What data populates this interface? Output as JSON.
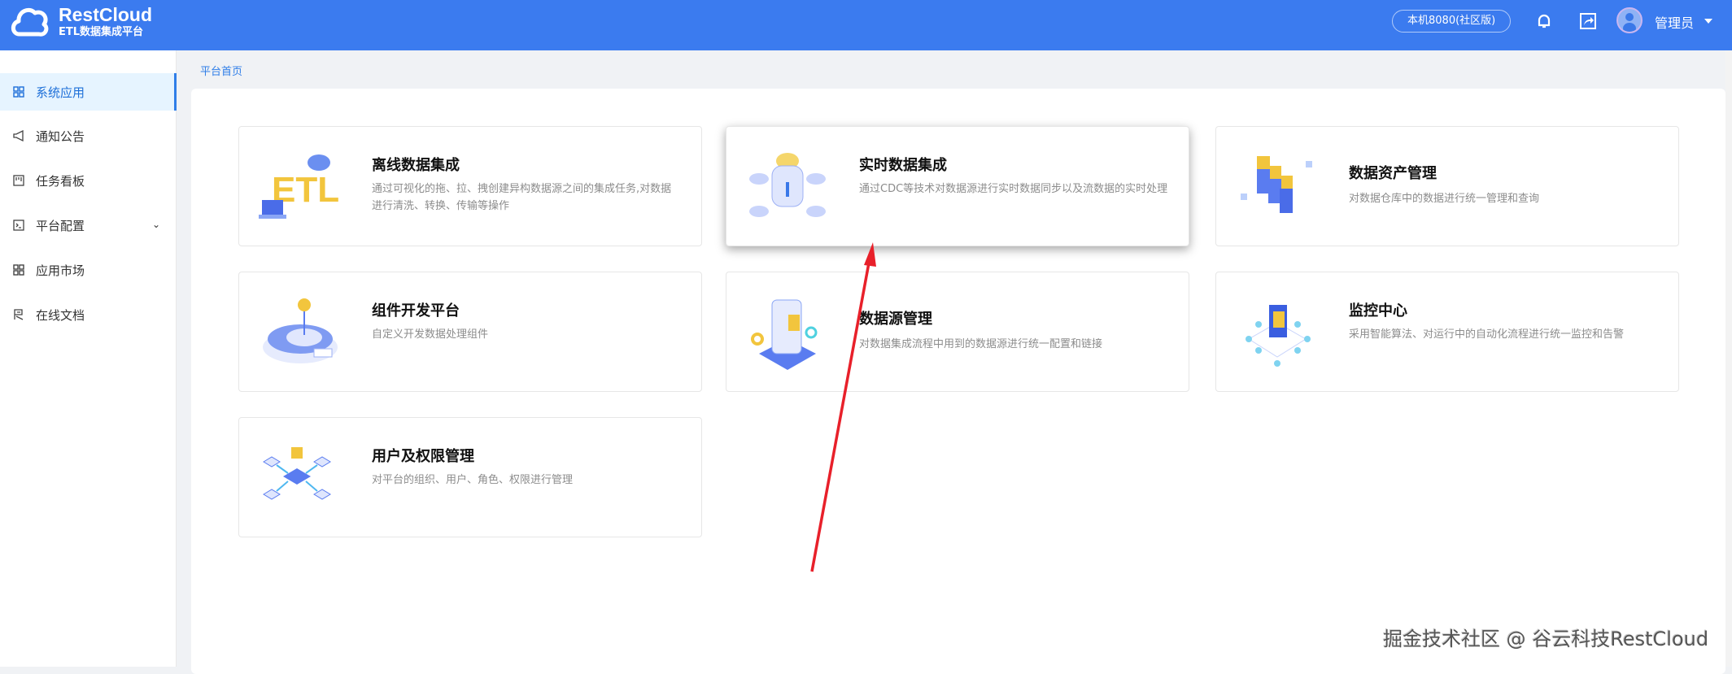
{
  "header": {
    "brand": "RestCloud",
    "subtitle": "ETL数据集成平台",
    "env_badge": "本机8080(社区版)",
    "user": "管理员"
  },
  "sidebar": {
    "items": [
      {
        "label": "系统应用",
        "icon": "grid-icon",
        "active": true
      },
      {
        "label": "通知公告",
        "icon": "megaphone-icon"
      },
      {
        "label": "任务看板",
        "icon": "board-icon"
      },
      {
        "label": "平台配置",
        "icon": "terminal-icon",
        "expandable": true
      },
      {
        "label": "应用市场",
        "icon": "grid-icon"
      },
      {
        "label": "在线文档",
        "icon": "document-icon"
      }
    ]
  },
  "breadcrumb": "平台首页",
  "cards": [
    {
      "title": "离线数据集成",
      "desc": "通过可视化的拖、拉、拽创建异构数据源之间的集成任务,对数据进行清洗、转换、传输等操作"
    },
    {
      "title": "实时数据集成",
      "desc": "通过CDC等技术对数据源进行实时数据同步以及流数据的实时处理"
    },
    {
      "title": "数据资产管理",
      "desc": "对数据仓库中的数据进行统一管理和查询"
    },
    {
      "title": "组件开发平台",
      "desc": "自定义开发数据处理组件"
    },
    {
      "title": "数据源管理",
      "desc": "对数据集成流程中用到的数据源进行统一配置和链接"
    },
    {
      "title": "监控中心",
      "desc": "采用智能算法、对运行中的自动化流程进行统一监控和告警"
    },
    {
      "title": "用户及权限管理",
      "desc": "对平台的组织、用户、角色、权限进行管理"
    }
  ],
  "watermark": "掘金技术社区 @ 谷云科技RestCloud",
  "colors": {
    "header": "#3b7bef",
    "accent": "#2f7ee8",
    "annotation": "#e8202a"
  }
}
